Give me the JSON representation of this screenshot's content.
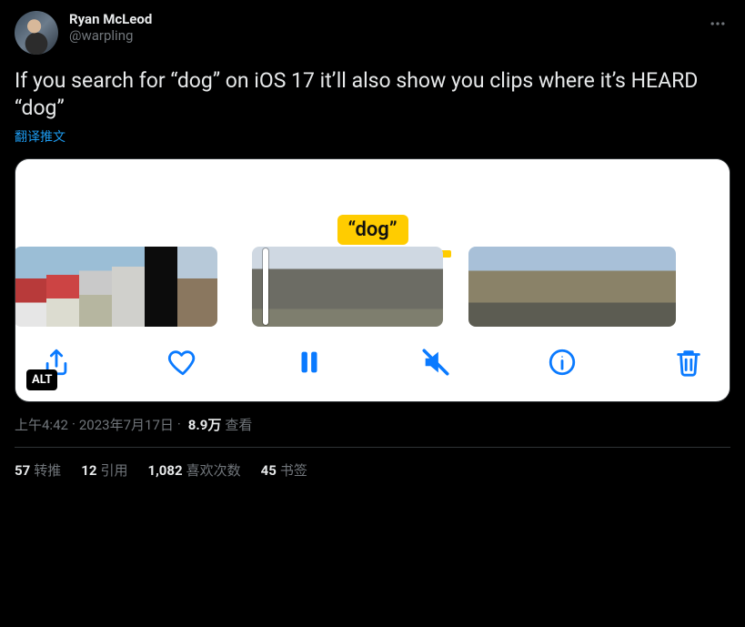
{
  "author": {
    "display_name": "Ryan McLeod",
    "handle": "@warpling"
  },
  "tweet_text": "If you search for “dog” on iOS 17 it’ll also show you clips where it’s HEARD “dog”",
  "translate_label": "翻译推文",
  "media": {
    "caption_text": "“dog”",
    "alt_badge": "ALT",
    "toolbar_icons": {
      "share": "share-icon",
      "heart": "heart-icon",
      "pause": "pause-icon",
      "mute": "mute-icon",
      "info": "info-icon",
      "trash": "trash-icon"
    }
  },
  "meta": {
    "time": "上午4:42",
    "dot1": " · ",
    "date": "2023年7月17日",
    "dot2": " · ",
    "views_value": "8.9万",
    "views_label": " 查看"
  },
  "stats": {
    "retweets": {
      "count": "57",
      "label": "转推"
    },
    "quotes": {
      "count": "12",
      "label": "引用"
    },
    "likes": {
      "count": "1,082",
      "label": "喜欢次数"
    },
    "bookmarks": {
      "count": "45",
      "label": "书签"
    }
  }
}
